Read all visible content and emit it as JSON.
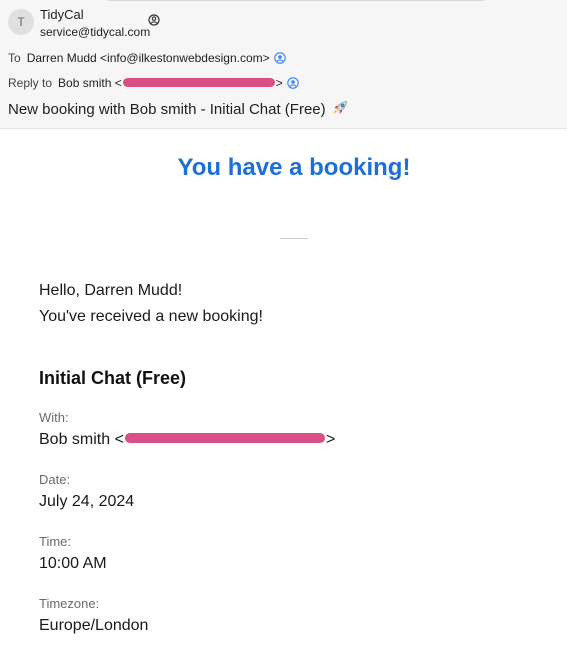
{
  "header": {
    "avatar_letter": "T",
    "sender_name": "TidyCal",
    "sender_email": "service@tidycal.com",
    "to_label": "To",
    "to_value": "Darren Mudd <info@ilkestonwebdesign.com>",
    "reply_label": "Reply to",
    "reply_name_prefix": "Bob smith <",
    "reply_suffix": ">",
    "subject": "New booking with Bob smith - Initial Chat (Free)"
  },
  "body": {
    "headline": "You have a booking!",
    "greeting": "Hello, Darren Mudd!",
    "received": "You've received a new booking!",
    "event_title": "Initial Chat (Free)",
    "with_label": "With:",
    "with_prefix": "Bob smith <",
    "with_suffix": ">",
    "date_label": "Date:",
    "date_value": "July 24, 2024",
    "time_label": "Time:",
    "time_value": "10:00 AM",
    "timezone_label": "Timezone:",
    "timezone_value": "Europe/London"
  },
  "colors": {
    "headline": "#1e70d8",
    "redaction": "#d94f86",
    "contact_icon": "#3b82f6"
  },
  "icons": {
    "sender_status": "person-status-icon",
    "contact": "contact-card-icon",
    "subject": "rocket-icon"
  }
}
